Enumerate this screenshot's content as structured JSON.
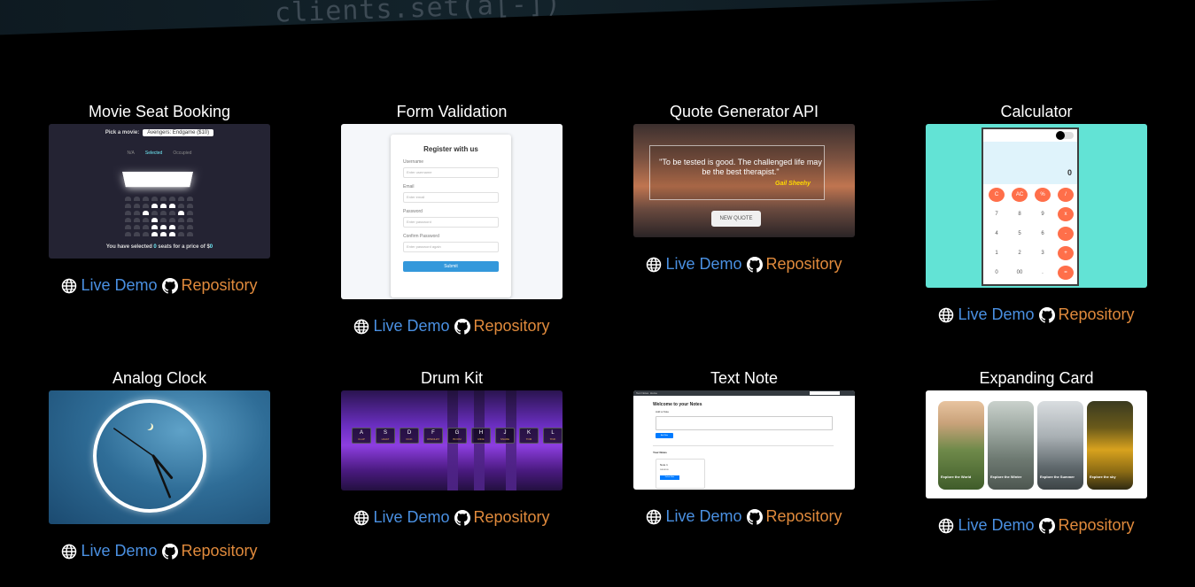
{
  "hero": {
    "code_snippet": "clients.set(a[-])"
  },
  "projects": [
    {
      "title": "Movie Seat Booking",
      "preview": {
        "pick_label": "Pick a movie:",
        "movie_option": "Avengers: Endgame ($10)",
        "legend": [
          "N/A",
          "Selected",
          "Occupied"
        ],
        "footer_prefix": "You have selected ",
        "selected_count": "0",
        "footer_mid": " seats for a price of $",
        "price": "0"
      },
      "live_demo": "Live Demo",
      "repository": "Repository"
    },
    {
      "title": "Form Validation",
      "preview": {
        "heading": "Register with us",
        "fields": [
          {
            "label": "Username",
            "placeholder": "Enter username"
          },
          {
            "label": "Email",
            "placeholder": "Enter email"
          },
          {
            "label": "Password",
            "placeholder": "Enter password"
          },
          {
            "label": "Confirm Password",
            "placeholder": "Enter password again"
          }
        ],
        "submit": "Submit"
      },
      "live_demo": "Live Demo",
      "repository": "Repository"
    },
    {
      "title": "Quote Generator API",
      "preview": {
        "quote": "\"To be tested is good. The challenged life may be the best therapist.\"",
        "author": "Gail Sheehy",
        "button": "NEW QUOTE"
      },
      "live_demo": "Live Demo",
      "repository": "Repository"
    },
    {
      "title": "Calculator",
      "preview": {
        "display": "0",
        "keys": [
          "C",
          "AC",
          "%",
          "/",
          "7",
          "8",
          "9",
          "x",
          "4",
          "5",
          "6",
          "-",
          "1",
          "2",
          "3",
          "+",
          "0",
          "00",
          ".",
          "="
        ]
      },
      "live_demo": "Live Demo",
      "repository": "Repository"
    },
    {
      "title": "Analog Clock",
      "preview": {
        "hour_deg": 140,
        "minute_deg": 158,
        "second_deg": -55
      },
      "live_demo": "Live Demo",
      "repository": "Repository"
    },
    {
      "title": "Drum Kit",
      "preview": {
        "keys": [
          {
            "key": "A",
            "sound": "CLAP"
          },
          {
            "key": "S",
            "sound": "HIHAT"
          },
          {
            "key": "D",
            "sound": "KICK"
          },
          {
            "key": "F",
            "sound": "OPENHAT"
          },
          {
            "key": "G",
            "sound": "BOOM"
          },
          {
            "key": "H",
            "sound": "RIDE"
          },
          {
            "key": "J",
            "sound": "SNARE"
          },
          {
            "key": "K",
            "sound": "TOM"
          },
          {
            "key": "L",
            "sound": "TINK"
          }
        ]
      },
      "live_demo": "Live Demo",
      "repository": "Repository"
    },
    {
      "title": "Text Note",
      "preview": {
        "brand": "Text Notes",
        "nav_home": "Home",
        "heading": "Welcome to your Notes",
        "add_label": "Add a Note",
        "add_button": "Add Note",
        "your_notes": "Your Notes",
        "note_title": "Note 1",
        "note_text": "sasasa",
        "delete_button": "Delete Note"
      },
      "live_demo": "Live Demo",
      "repository": "Repository"
    },
    {
      "title": "Expanding Card",
      "preview": {
        "cards": [
          "Explore the World",
          "Explore the Winter",
          "Explore the Summer",
          "Explore the sky"
        ]
      },
      "live_demo": "Live Demo",
      "repository": "Repository"
    }
  ]
}
